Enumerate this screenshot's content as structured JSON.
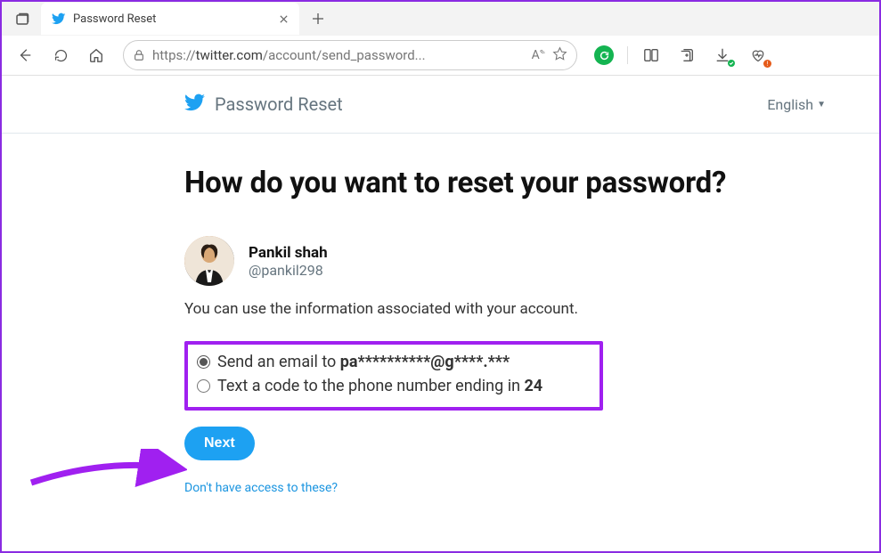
{
  "browser": {
    "tab_title": "Password Reset",
    "url_prefix": "https://",
    "url_host": "twitter.com",
    "url_path": "/account/send_password...",
    "reader_badge": "A"
  },
  "header": {
    "title": "Password Reset",
    "language": "English"
  },
  "page": {
    "heading": "How do you want to reset your password?",
    "user_name": "Pankil shah",
    "user_handle": "@pankil298",
    "instruction": "You can use the information associated with your account.",
    "option_email_prefix": "Send an email to ",
    "option_email_value": "pa**********@g****.***",
    "option_sms_prefix": "Text a code to the phone number ending in ",
    "option_sms_value": "24",
    "next_label": "Next",
    "help_link": "Don't have access to these?"
  }
}
